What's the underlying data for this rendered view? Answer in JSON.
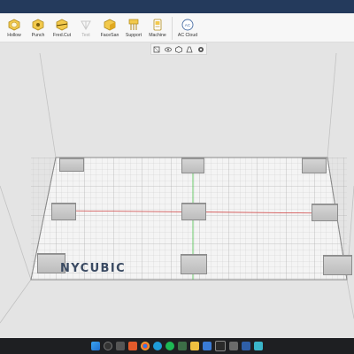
{
  "toolbar": {
    "tools": [
      {
        "label": "Hollow",
        "icon": "hollow-icon",
        "disabled": false
      },
      {
        "label": "Punch",
        "icon": "punch-icon",
        "disabled": false
      },
      {
        "label": "Fred.Cut",
        "icon": "cut-icon",
        "disabled": false
      },
      {
        "label": "Text",
        "icon": "text-icon",
        "disabled": true
      },
      {
        "label": "FaceSan",
        "icon": "face-icon",
        "disabled": false
      },
      {
        "label": "Support",
        "icon": "support-icon",
        "disabled": false
      },
      {
        "label": "Machine",
        "icon": "machine-icon",
        "disabled": false
      },
      {
        "label": "AC Cloud",
        "icon": "cloud-icon",
        "disabled": false
      }
    ]
  },
  "viewbar": {
    "icons": [
      "view-cube-icon",
      "visibility-icon",
      "view-preset-icon",
      "perspective-icon",
      "settings-icon"
    ]
  },
  "brand": {
    "text": "NYCUBIC"
  },
  "colors": {
    "accent": "#3a4a62",
    "x_axis": "#d24a4a",
    "y_axis": "#4cc04c",
    "grid": "#b8b8b8",
    "plate": "#cfcfcf"
  },
  "taskbar": {
    "icons": [
      "windows-start-icon",
      "search-icon",
      "task-view-icon",
      "brave-browser-icon",
      "chrome-icon",
      "edge-icon",
      "spotify-icon",
      "app-icon",
      "files-icon",
      "photos-icon",
      "terminal-icon",
      "settings-icon",
      "vpn-icon",
      "slicer-icon"
    ]
  }
}
